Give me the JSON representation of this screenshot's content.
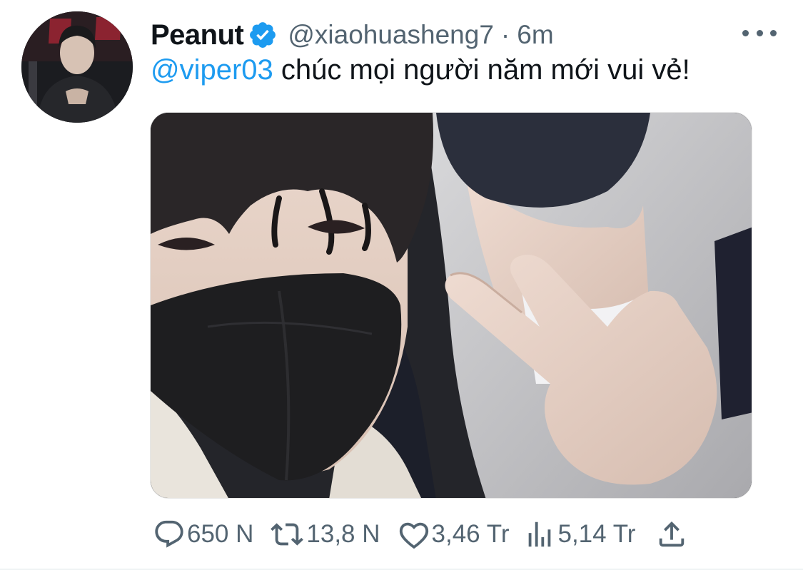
{
  "tweet": {
    "author": {
      "display_name": "Peanut",
      "handle": "@xiaohuasheng7",
      "verified_icon": "verified-badge-icon",
      "avatar_icon": "profile-avatar"
    },
    "separator": "·",
    "time": "6m",
    "more_icon": "more-horizontal-icon",
    "text": {
      "mention": "@viper03",
      "body": "chúc mọi người năm mới vui vẻ!"
    },
    "media_icon": "attached-photo"
  },
  "actions": {
    "reply": {
      "icon": "reply-bubble-icon",
      "count": "650 N"
    },
    "retweet": {
      "icon": "retweet-icon",
      "count": "13,8 N"
    },
    "like": {
      "icon": "heart-icon",
      "count": "3,46 Tr"
    },
    "views": {
      "icon": "bar-chart-icon",
      "count": "5,14 Tr"
    },
    "share": {
      "icon": "share-upload-icon"
    }
  },
  "colors": {
    "link": "#1d9bf0",
    "text": "#0f1419",
    "muted": "#536471",
    "verified": "#1d9bf0"
  }
}
